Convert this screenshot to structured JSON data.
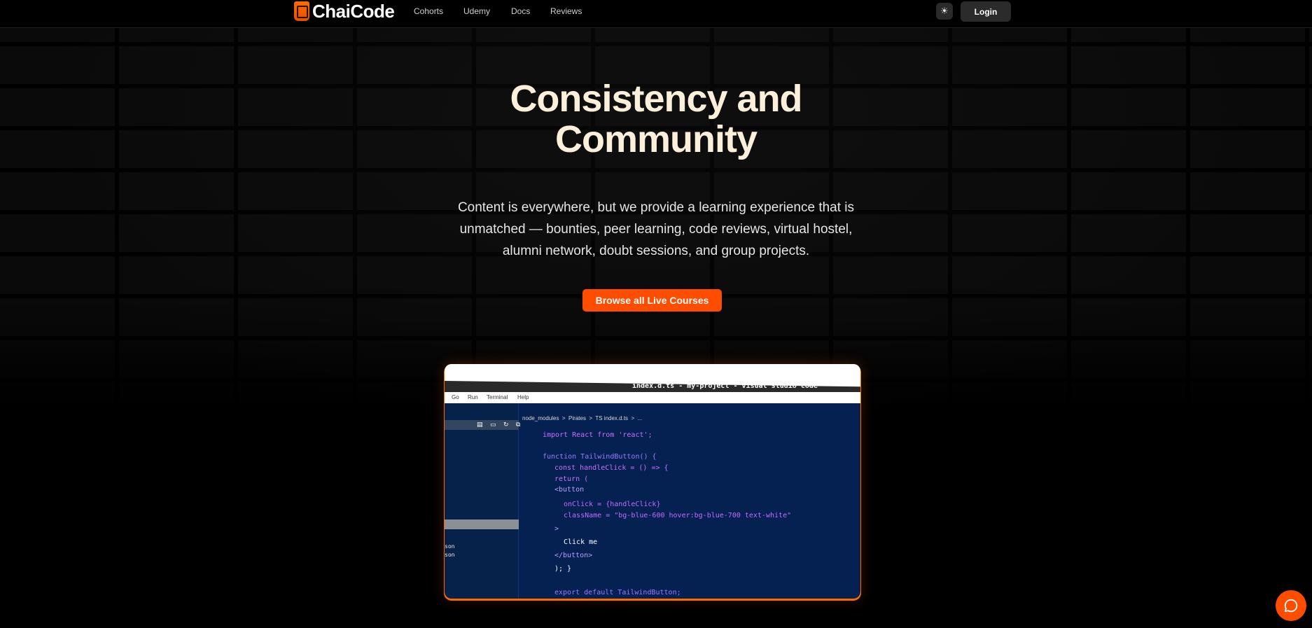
{
  "nav": {
    "logo_text": "ChaiCode",
    "links": [
      "Cohorts",
      "Udemy",
      "Docs",
      "Reviews"
    ],
    "theme_icon": "sun-icon",
    "login_label": "Login"
  },
  "hero": {
    "title": "Consistency and Community",
    "subtitle": "Content is everywhere, but we provide a learning experience that is unmatched — bounties, peer learning, code reviews, virtual hostel, alumni network, doubt sessions, and group projects.",
    "cta_label": "Browse all Live Courses"
  },
  "editor": {
    "window_title": "index.d.ts - my-project - visual studio code",
    "menu": [
      "Go",
      "Run",
      "Terminal",
      "Help"
    ],
    "breadcrumb": "node_modules  >  Pirates  >  TS index.d.ts  >  ...",
    "sidebar_files": [
      "son",
      "son"
    ],
    "code_lines": [
      "import React from 'react';",
      "function TailwindButton() {",
      "const handleClick = () => {",
      "return (",
      "<button",
      "onClick = {handleClick}",
      "className = \"bg-blue-600 hover:bg-blue-700 text-white\"",
      ">",
      "Click me",
      "</button>",
      "); }",
      "export default TailwindButton;"
    ]
  },
  "chat": {
    "icon": "chat-icon"
  },
  "colors": {
    "accent": "#ff4d00",
    "title": "#fdf0db",
    "editor_bg": "#042152"
  }
}
